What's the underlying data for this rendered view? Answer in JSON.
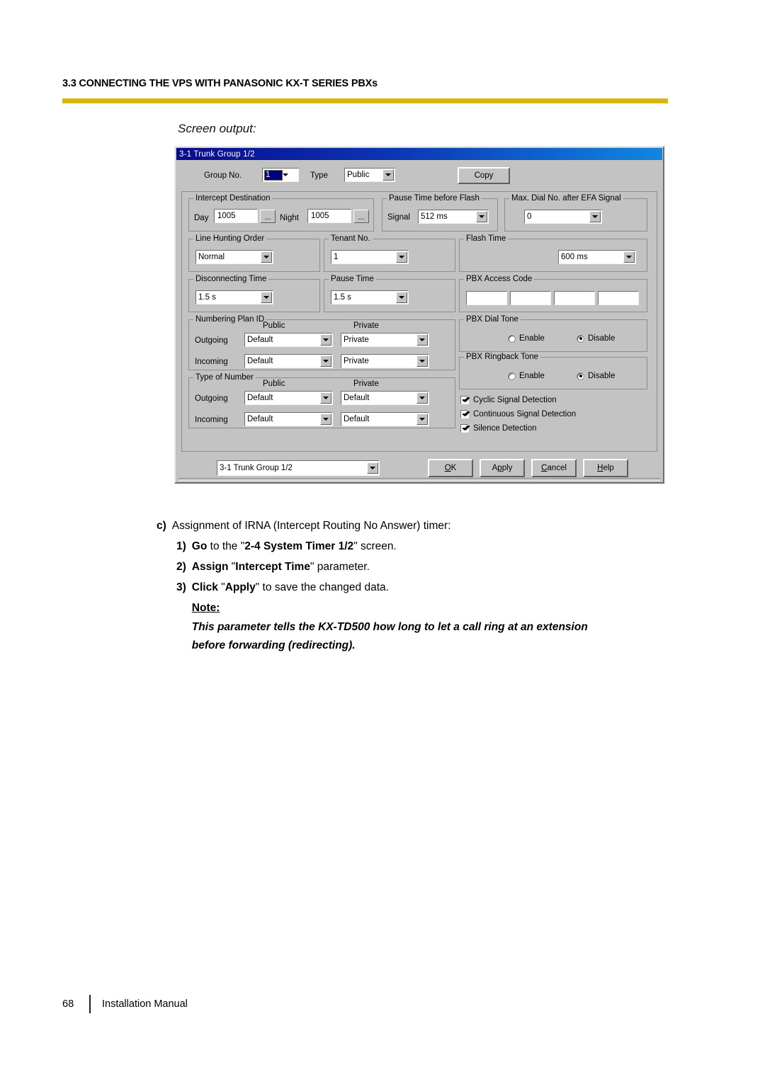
{
  "header": {
    "section_title": "3.3 CONNECTING THE VPS WITH PANASONIC KX-T SERIES PBXs",
    "rule_color": "#d9b60d"
  },
  "screen_output_label": "Screen output:",
  "dialog": {
    "title": "3-1 Trunk Group 1/2",
    "titlebar_color_start": "#0a0a8c",
    "titlebar_color_end": "#1186e0",
    "top_row": {
      "group_no_label": "Group No.",
      "group_no_value": "1",
      "type_label": "Type",
      "type_value": "Public",
      "copy_button": "Copy"
    },
    "intercept_destination": {
      "legend": "Intercept Destination",
      "day_label": "Day",
      "day_value": "1005",
      "day_browse": "...",
      "night_label": "Night",
      "night_value": "1005",
      "night_browse": "..."
    },
    "pause_time_before_flash": {
      "legend": "Pause Time before Flash",
      "signal_label": "Signal",
      "signal_value": "512 ms"
    },
    "max_dial_no_after_efa": {
      "legend": "Max. Dial No. after EFA Signal",
      "value": "0"
    },
    "line_hunting_order": {
      "legend": "Line Hunting Order",
      "value": "Normal"
    },
    "tenant_no": {
      "legend": "Tenant No.",
      "value": "1"
    },
    "flash_time": {
      "legend": "Flash Time",
      "value": "600 ms"
    },
    "disconnecting_time": {
      "legend": "Disconnecting Time",
      "value": "1.5 s"
    },
    "pause_time": {
      "legend": "Pause Time",
      "value": "1.5 s"
    },
    "pbx_access_code": {
      "legend": "PBX Access Code",
      "values": [
        "",
        "",
        "",
        ""
      ]
    },
    "numbering_plan_id": {
      "legend": "Numbering Plan ID",
      "col_public": "Public",
      "col_private": "Private",
      "rows": [
        {
          "label": "Outgoing",
          "public": "Default",
          "private": "Private"
        },
        {
          "label": "Incoming",
          "public": "Default",
          "private": "Private"
        }
      ]
    },
    "type_of_number": {
      "legend": "Type of Number",
      "col_public": "Public",
      "col_private": "Private",
      "rows": [
        {
          "label": "Outgoing",
          "public": "Default",
          "private": "Default"
        },
        {
          "label": "Incoming",
          "public": "Default",
          "private": "Default"
        }
      ]
    },
    "pbx_dial_tone": {
      "legend": "PBX Dial Tone",
      "enable_label": "Enable",
      "disable_label": "Disable",
      "selected": "Disable"
    },
    "pbx_ringback_tone": {
      "legend": "PBX Ringback Tone",
      "enable_label": "Enable",
      "disable_label": "Disable",
      "selected": "Disable"
    },
    "detection_checks": [
      {
        "label": "Cyclic Signal Detection",
        "checked": true
      },
      {
        "label": "Continuous Signal Detection",
        "checked": true
      },
      {
        "label": "Silence Detection",
        "checked": true
      }
    ],
    "footer_bar": {
      "screen_selector_value": "3-1 Trunk Group 1/2",
      "buttons": [
        {
          "pre": "",
          "accel": "O",
          "post": "K",
          "name": "ok"
        },
        {
          "pre": "A",
          "accel": "p",
          "post": "ply",
          "name": "apply"
        },
        {
          "pre": "",
          "accel": "C",
          "post": "ancel",
          "name": "cancel"
        },
        {
          "pre": "",
          "accel": "H",
          "post": "elp",
          "name": "help"
        }
      ]
    }
  },
  "instructions": {
    "item_c_marker": "c)",
    "item_c_text": "Assignment of IRNA (Intercept Routing No Answer) timer:",
    "step1_marker": "1)",
    "step1_bold_a": "Go",
    "step1_mid": " to the \"",
    "step1_bold_b": "2-4 System Timer 1/2",
    "step1_end": "\" screen.",
    "step2_marker": "2)",
    "step2_bold_a": "Assign",
    "step2_mid": " \"",
    "step2_bold_b": "Intercept Time",
    "step2_end": "\" parameter.",
    "step3_marker": "3)",
    "step3_bold_a": "Click",
    "step3_mid": " \"",
    "step3_bold_b": "Apply",
    "step3_end": "\" to save the changed data.",
    "note_title": "Note:",
    "note_line1": "This parameter tells the KX-TD500 how long to let a call ring at an extension",
    "note_line2": "before forwarding (redirecting)."
  },
  "footer": {
    "page_number": "68",
    "doc_title": "Installation Manual"
  }
}
